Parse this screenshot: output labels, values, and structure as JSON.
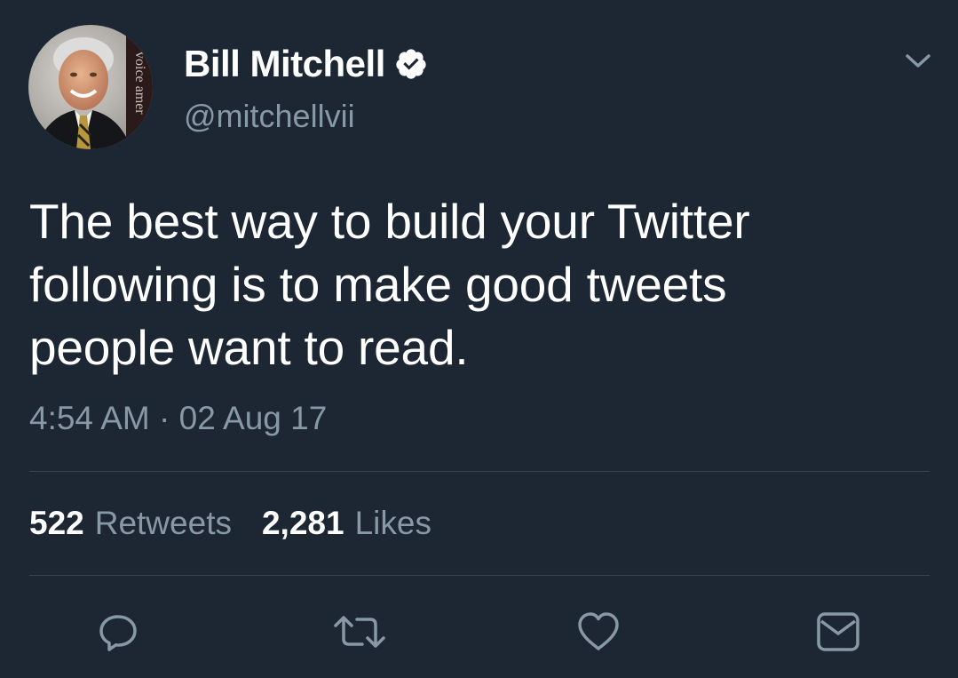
{
  "tweet": {
    "author": {
      "display_name": "Bill Mitchell",
      "handle": "@mitchellvii",
      "verified": true,
      "avatar_backdrop_text": "voice amer"
    },
    "text_lines": [
      "The best way to build your Twitter",
      "following is to make good tweets",
      "people want to read."
    ],
    "timestamp": "4:54 AM · 02 Aug 17",
    "stats": {
      "retweets_count": "522",
      "retweets_label": "Retweets",
      "likes_count": "2,281",
      "likes_label": "Likes"
    }
  },
  "icons": {
    "menu": "chevron-down-icon",
    "verified": "verified-badge-icon",
    "reply": "reply-icon",
    "retweet": "retweet-icon",
    "like": "heart-icon",
    "message": "envelope-icon"
  },
  "colors": {
    "background": "#1c2733",
    "primary_text": "#ffffff",
    "secondary_text": "#8899a6",
    "divider": "#38444d"
  }
}
